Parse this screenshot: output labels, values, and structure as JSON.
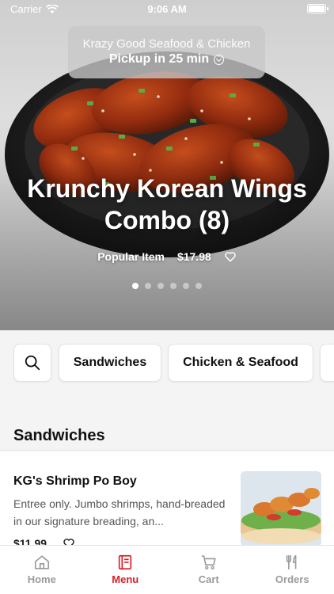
{
  "status_bar": {
    "carrier": "Carrier",
    "time": "9:06 AM"
  },
  "store": {
    "name": "Krazy Good Seafood & Chicken",
    "pickup": "Pickup in 25 min"
  },
  "hero": {
    "title": "Krunchy Korean Wings Combo (8)",
    "badge": "Popular Item",
    "price": "$17.98",
    "slide_count": 6,
    "active_slide": 1
  },
  "categories": [
    {
      "label": "Sandwiches"
    },
    {
      "label": "Chicken & Seafood"
    }
  ],
  "section": {
    "title": "Sandwiches"
  },
  "menu_item": {
    "name": "KG's Shrimp Po Boy",
    "description": "Entree only. Jumbo shrimps, hand-breaded in our signature breading, an...",
    "price": "$11.99"
  },
  "tabs": [
    {
      "label": "Home",
      "icon": "home-icon"
    },
    {
      "label": "Menu",
      "icon": "menu-icon",
      "active": true
    },
    {
      "label": "Cart",
      "icon": "cart-icon"
    },
    {
      "label": "Orders",
      "icon": "fork-knife-icon"
    }
  ],
  "colors": {
    "accent": "#d91e27",
    "inactive_tab": "#9b9b9b"
  }
}
